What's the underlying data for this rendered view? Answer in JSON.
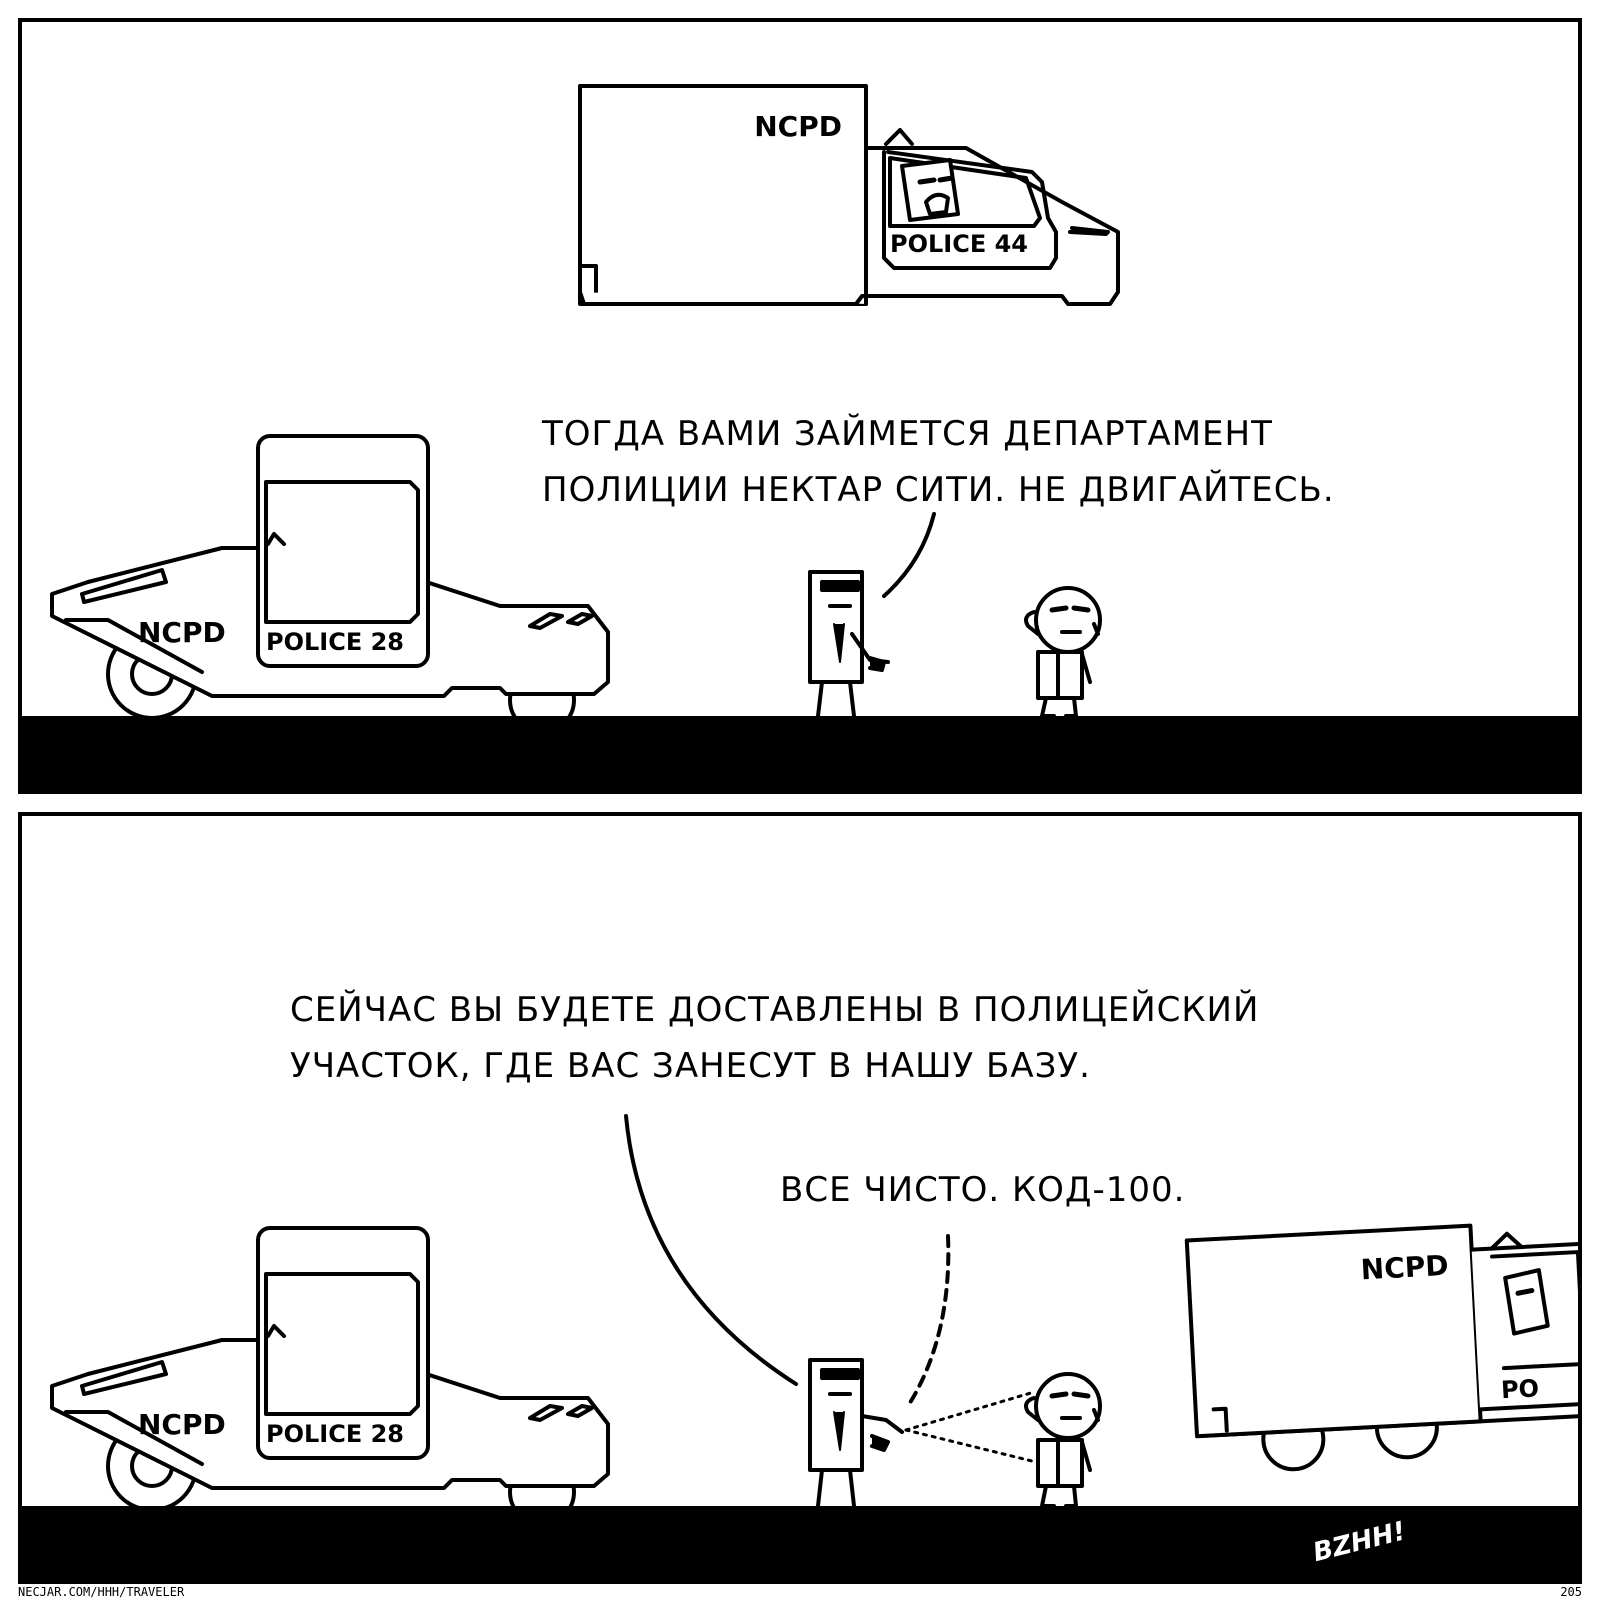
{
  "panel1": {
    "hover_van": {
      "brand": "NCPD",
      "plate": "POLICE 44"
    },
    "patrol_car": {
      "brand": "NCPD",
      "plate": "POLICE 28"
    },
    "speech": {
      "line1": "ТОГДА ВАМИ ЗАЙМЕТСЯ ДЕПАРТАМЕНТ",
      "line2": "ПОЛИЦИИ НЕКТАР СИТИ. НЕ ДВИГАЙТЕСЬ."
    }
  },
  "panel2": {
    "patrol_car": {
      "brand": "NCPD",
      "plate": "POLICE 28"
    },
    "hover_van": {
      "brand": "NCPD",
      "plate_partial": "PO"
    },
    "speech": {
      "line1": "СЕЙЧАС ВЫ БУДЕТЕ ДОСТАВЛЕНЫ В ПОЛИЦЕЙСКИЙ",
      "line2": "УЧАСТОК, ГДЕ ВАС ЗАНЕСУТ В НАШУ БАЗУ."
    },
    "radio": "ВСЕ ЧИСТО. КОД-100.",
    "sfx": "BZHH!"
  },
  "footer": {
    "url": "NECJAR.COM/HHH/TRAVELER",
    "page_number": "205"
  }
}
